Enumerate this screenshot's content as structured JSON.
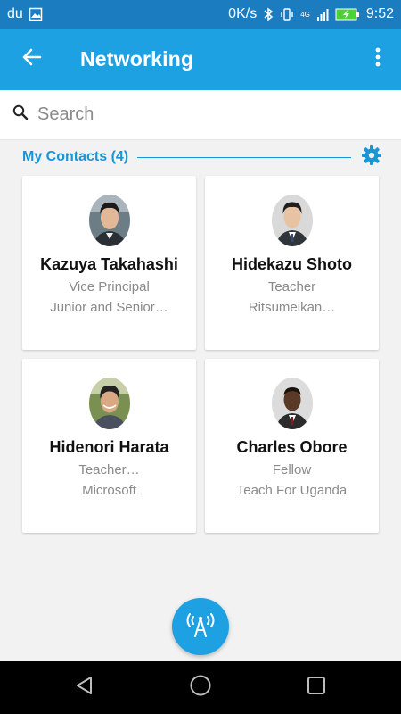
{
  "status_bar": {
    "carrier": "du",
    "net_speed": "0K/s",
    "network_type": "4G",
    "time": "9:52",
    "icons": [
      "image-icon",
      "bluetooth-icon",
      "vibrate-icon",
      "signal-icon",
      "battery-charging-icon"
    ]
  },
  "app_bar": {
    "title": "Networking",
    "back_icon": "arrow-left-icon",
    "menu_icon": "more-vertical-icon"
  },
  "search": {
    "placeholder": "Search",
    "value": ""
  },
  "contacts": {
    "header": "My Contacts (4)",
    "settings_icon": "gear-icon",
    "accent_color": "#1a95d6",
    "items": [
      {
        "name": "Kazuya Takahashi",
        "title": "Vice Principal",
        "org": "Junior and Senior…"
      },
      {
        "name": "Hidekazu Shoto",
        "title": "Teacher",
        "org": "Ritsumeikan…"
      },
      {
        "name": "Hidenori Harata",
        "title": "Teacher…",
        "org": "Microsoft"
      },
      {
        "name": "Charles Obore",
        "title": "Fellow",
        "org": "Teach For Uganda"
      }
    ]
  },
  "fab": {
    "icon": "broadcast-icon",
    "color": "#1da1e2"
  },
  "nav_bar": {
    "icons": [
      "back-triangle-icon",
      "home-circle-icon",
      "recents-square-icon"
    ]
  }
}
